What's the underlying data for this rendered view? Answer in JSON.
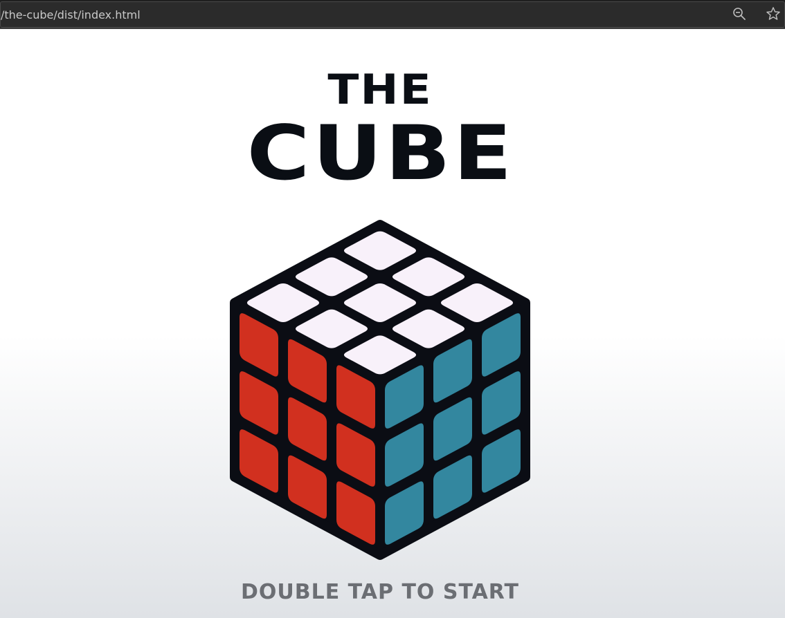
{
  "browser": {
    "url": "/the-cube/dist/index.html",
    "icons": [
      "zoom-out-icon",
      "bookmark-star-icon"
    ]
  },
  "title": {
    "line1": "THE",
    "line2": "CUBE"
  },
  "cube": {
    "faces": {
      "top": [
        "white",
        "white",
        "white",
        "white",
        "white",
        "white",
        "white",
        "white",
        "white"
      ],
      "left": [
        "red",
        "red",
        "red",
        "red",
        "red",
        "red",
        "red",
        "red",
        "red"
      ],
      "right": [
        "blue",
        "blue",
        "blue",
        "blue",
        "blue",
        "blue",
        "blue",
        "blue",
        "blue"
      ]
    },
    "colors": {
      "white": "#f8f1fa",
      "red": "#d1301f",
      "blue": "#33879f",
      "body": "#0b0d14"
    }
  },
  "prompt": {
    "text": "DOUBLE TAP TO START"
  },
  "theme": {
    "background_top": "#ffffff",
    "background_bottom": "#dfe2e6",
    "title_color": "#0a0e14",
    "prompt_color": "#6b6e73"
  }
}
